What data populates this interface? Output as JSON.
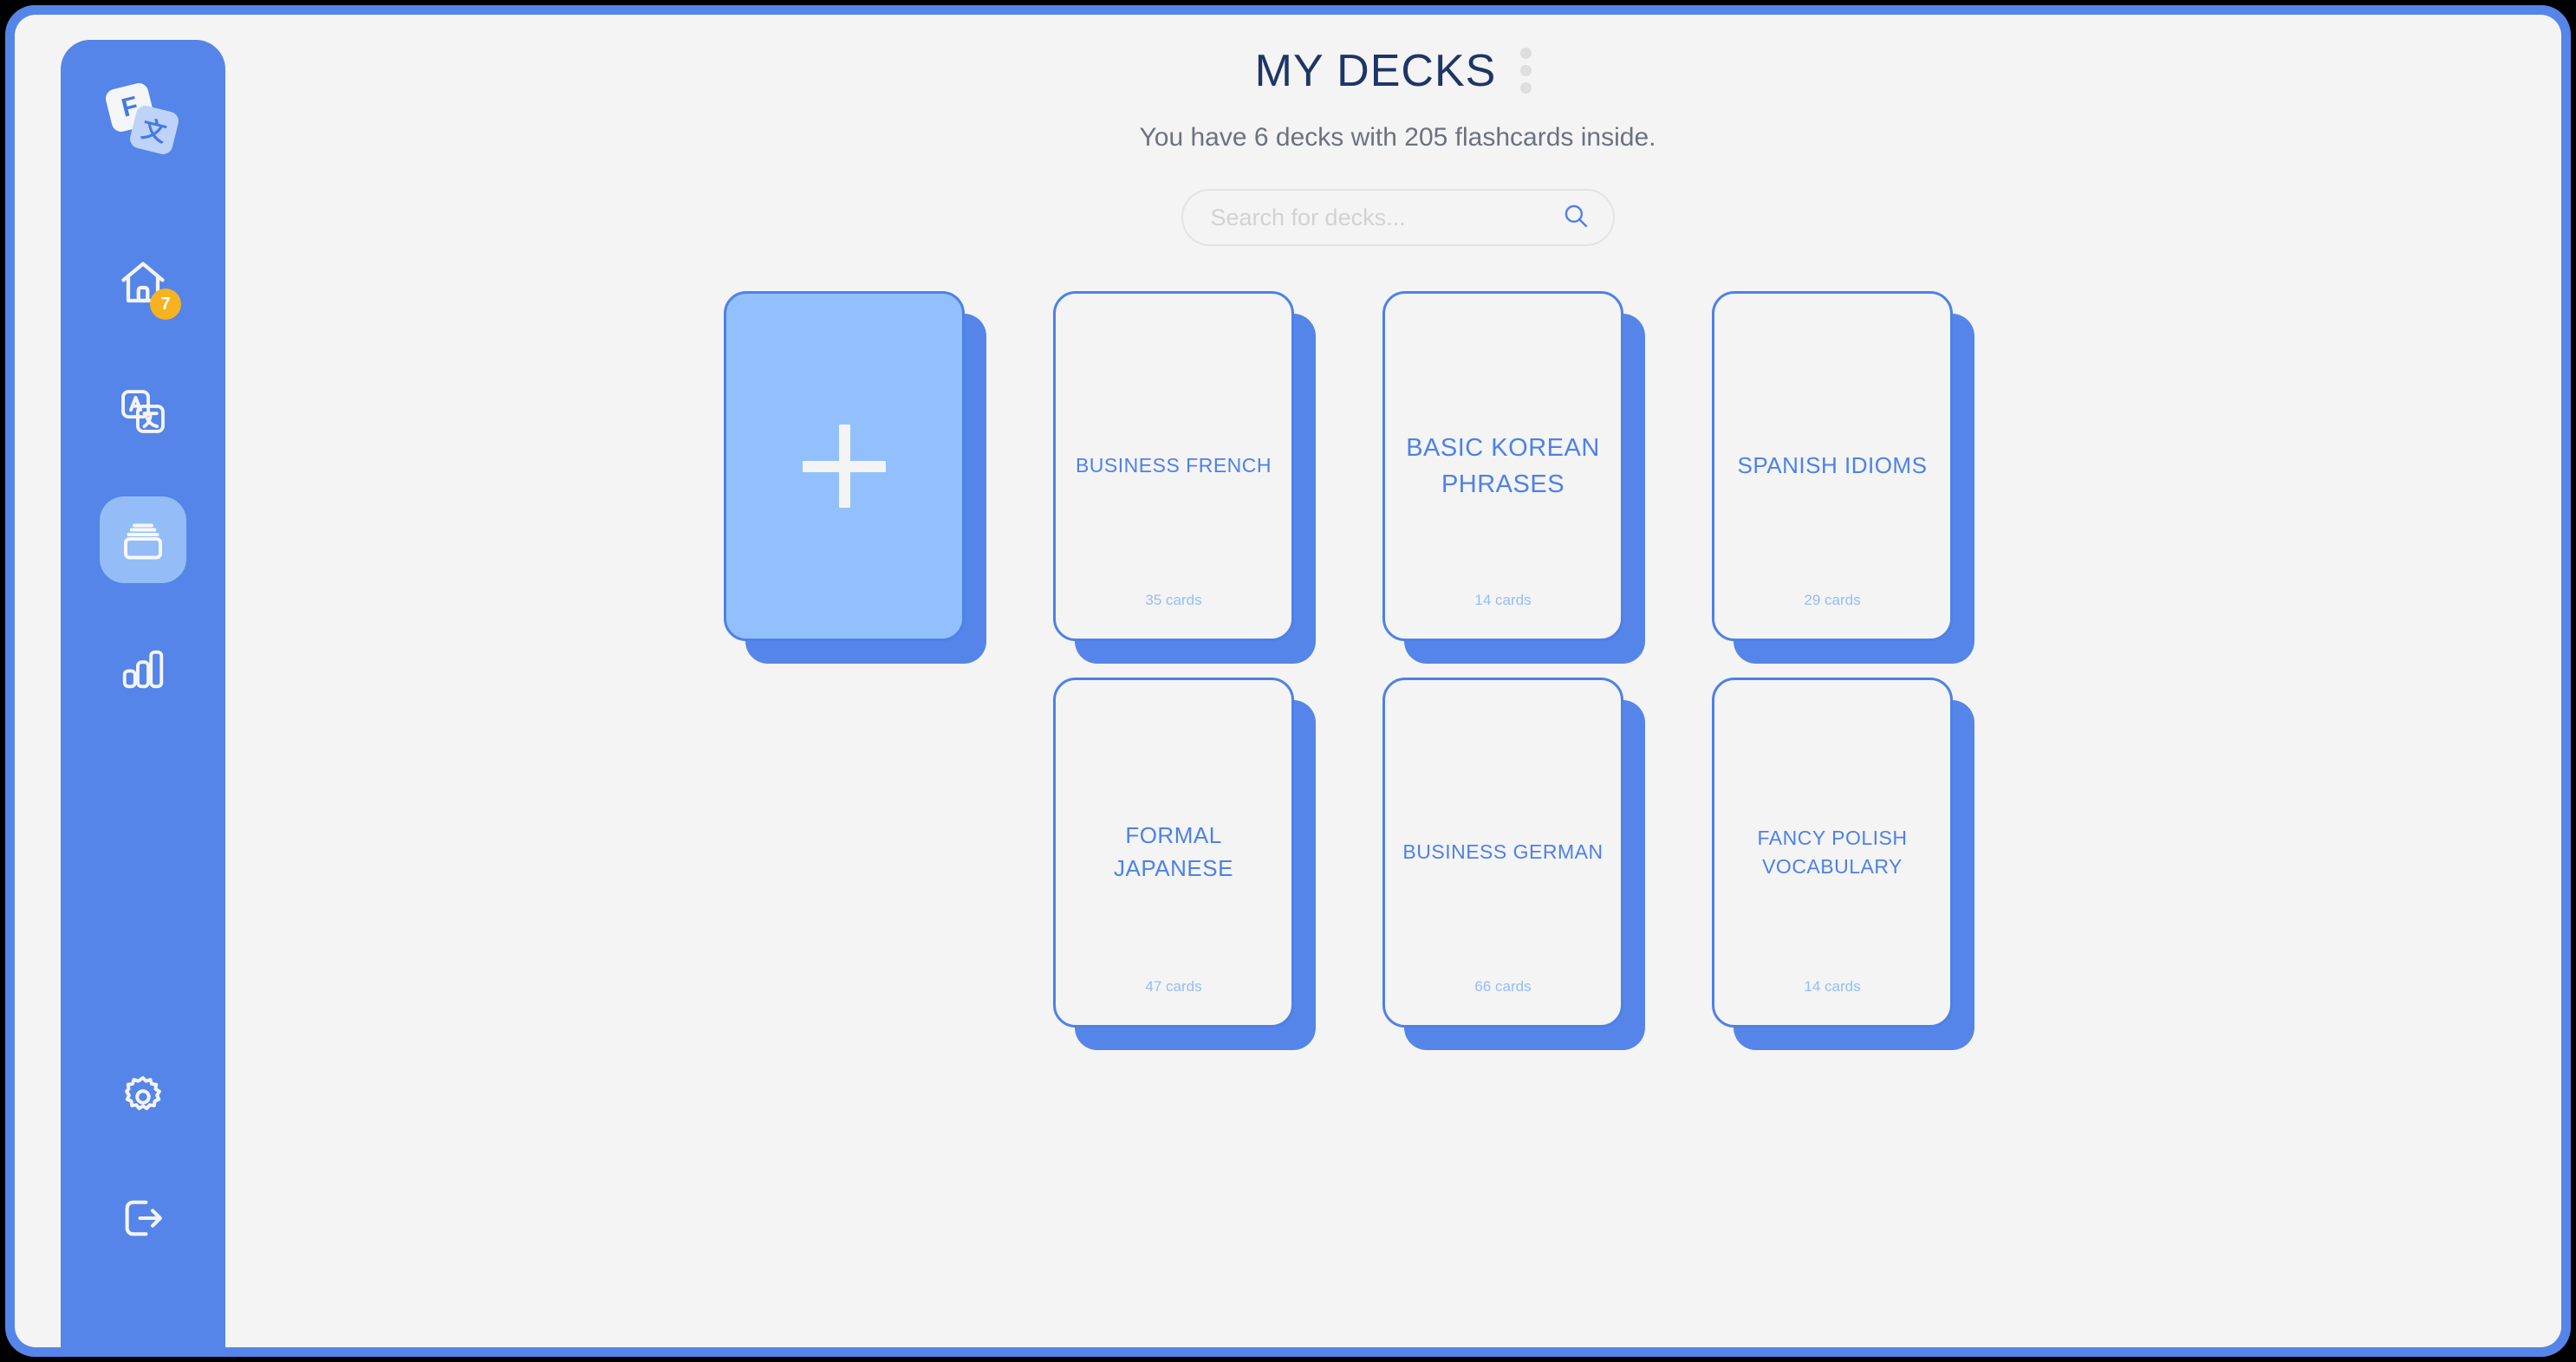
{
  "app": {
    "logo": {
      "front_letter": "F",
      "back_letter": "文"
    }
  },
  "sidebar": {
    "items": [
      {
        "name": "home",
        "icon": "home-icon",
        "badge": "7",
        "active": false
      },
      {
        "name": "translate",
        "icon": "translate-icon",
        "badge": "",
        "active": false
      },
      {
        "name": "decks",
        "icon": "card-box-icon",
        "badge": "",
        "active": true
      },
      {
        "name": "stats",
        "icon": "bar-chart-icon",
        "badge": "",
        "active": false
      }
    ],
    "bottom_items": [
      {
        "name": "settings",
        "icon": "gear-icon"
      },
      {
        "name": "logout",
        "icon": "logout-icon"
      }
    ]
  },
  "header": {
    "title": "MY DECKS",
    "subtitle": "You have 6 decks with 205 flashcards inside.",
    "menu_icon": "kebab-menu-icon"
  },
  "search": {
    "placeholder": "Search for decks...",
    "value": "",
    "icon": "search-icon"
  },
  "decks": {
    "add_label": "+",
    "items": [
      {
        "title": "BUSINESS FRENCH",
        "count": "35 cards",
        "size": "sz-s"
      },
      {
        "title": "BASIC KOREAN PHRASES",
        "count": "14 cards",
        "size": "sz-l"
      },
      {
        "title": "SPANISH IDIOMS",
        "count": "29 cards",
        "size": "sz-m"
      },
      {
        "title": "FORMAL JAPANESE",
        "count": "47 cards",
        "size": "sz-m"
      },
      {
        "title": "BUSINESS GERMAN",
        "count": "66 cards",
        "size": "sz-s"
      },
      {
        "title": "FANCY POLISH VOCABULARY",
        "count": "14 cards",
        "size": "sz-s"
      }
    ]
  },
  "colors": {
    "brand_blue": "#5585e8",
    "deck_border": "#4d81e8",
    "add_card_fill": "#92c0fc",
    "title_navy": "#1e3566",
    "badge_amber": "#f5b221",
    "canvas": "#f4f4f4"
  }
}
